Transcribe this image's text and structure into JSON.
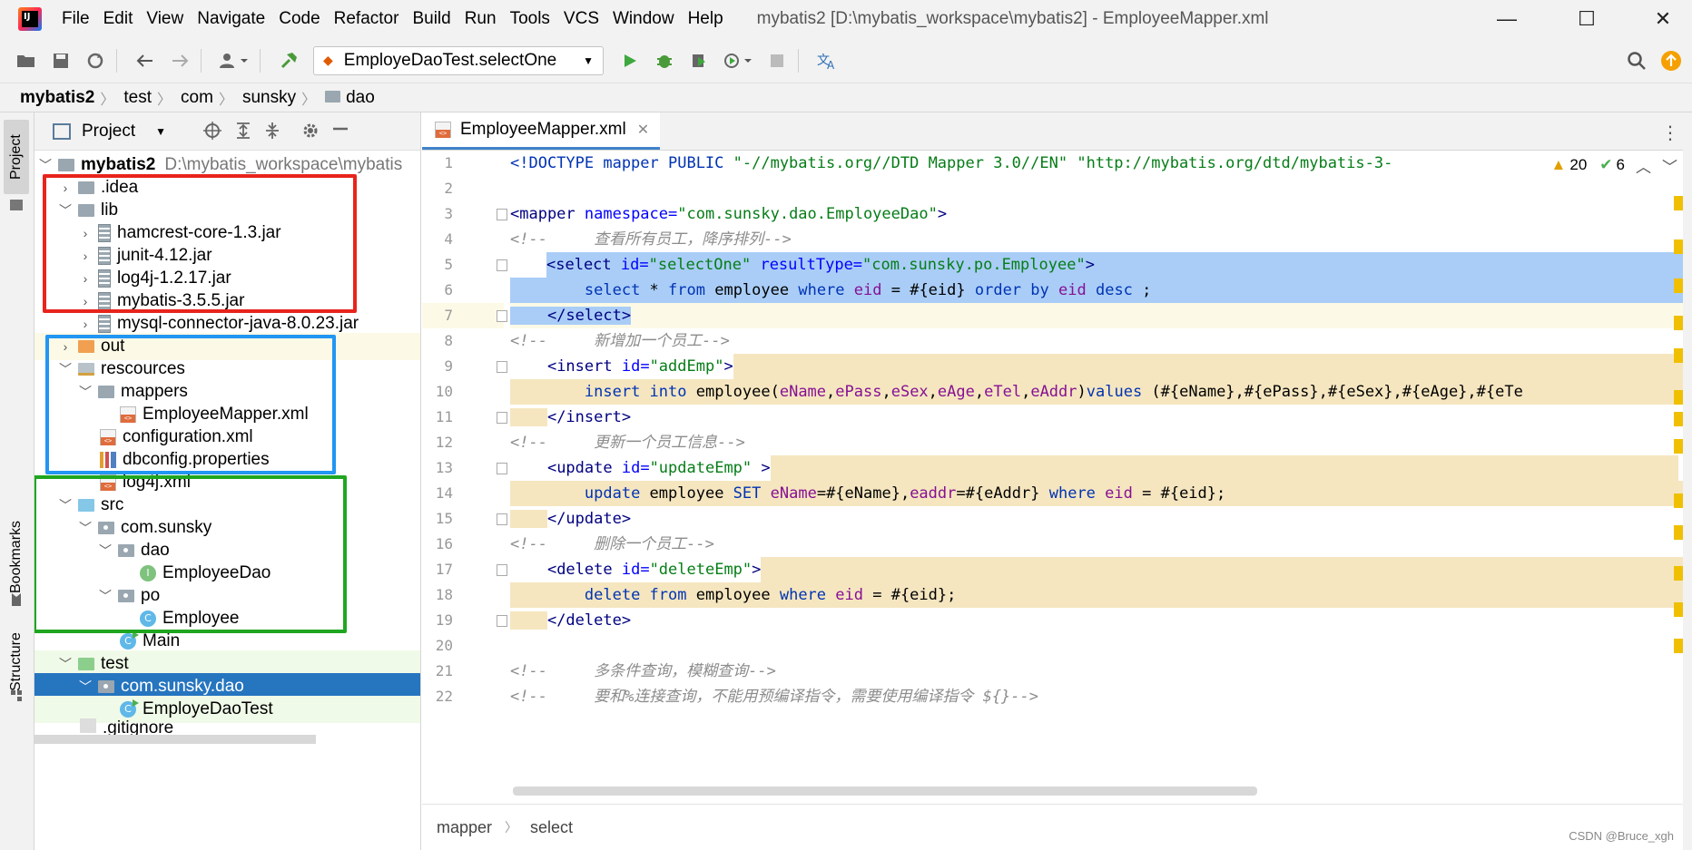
{
  "menubar": {
    "items": [
      "File",
      "Edit",
      "View",
      "Navigate",
      "Code",
      "Refactor",
      "Build",
      "Run",
      "Tools",
      "VCS",
      "Window",
      "Help"
    ],
    "window_title": "mybatis2 [D:\\mybatis_workspace\\mybatis2] - EmployeeMapper.xml",
    "minimize": "—",
    "maximize": "☐",
    "close": "✕"
  },
  "toolbar": {
    "run_config": "EmployeDaoTest.selectOne"
  },
  "breadcrumb": [
    "mybatis2",
    "test",
    "com",
    "sunsky",
    "dao"
  ],
  "left_strip": {
    "project": "Project",
    "bookmarks": "Bookmarks",
    "structure": "Structure"
  },
  "project_panel": {
    "title": "Project",
    "tree": [
      {
        "label": "mybatis2",
        "path": "D:\\mybatis_workspace\\mybatis",
        "icon": "project-folder-icon"
      },
      {
        "label": ".idea",
        "icon": "folder-icon"
      },
      {
        "label": "lib",
        "icon": "folder-icon"
      },
      {
        "label": "hamcrest-core-1.3.jar",
        "icon": "jar-icon"
      },
      {
        "label": "junit-4.12.jar",
        "icon": "jar-icon"
      },
      {
        "label": "log4j-1.2.17.jar",
        "icon": "jar-icon"
      },
      {
        "label": "mybatis-3.5.5.jar",
        "icon": "jar-icon"
      },
      {
        "label": "mysql-connector-java-8.0.23.jar",
        "icon": "jar-icon"
      },
      {
        "label": "out",
        "icon": "excluded-folder-icon"
      },
      {
        "label": "rescources",
        "icon": "resources-folder-icon"
      },
      {
        "label": "mappers",
        "icon": "folder-icon"
      },
      {
        "label": "EmployeeMapper.xml",
        "icon": "xml-file-icon"
      },
      {
        "label": "configuration.xml",
        "icon": "xml-file-icon"
      },
      {
        "label": "dbconfig.properties",
        "icon": "properties-file-icon"
      },
      {
        "label": "log4j.xml",
        "icon": "xml-file-icon"
      },
      {
        "label": "src",
        "icon": "source-folder-icon"
      },
      {
        "label": "com.sunsky",
        "icon": "package-icon"
      },
      {
        "label": "dao",
        "icon": "package-icon"
      },
      {
        "label": "EmployeeDao",
        "icon": "interface-icon"
      },
      {
        "label": "po",
        "icon": "package-icon"
      },
      {
        "label": "Employee",
        "icon": "class-icon"
      },
      {
        "label": "Main",
        "icon": "runnable-class-icon"
      },
      {
        "label": "test",
        "icon": "test-folder-icon"
      },
      {
        "label": "com.sunsky.dao",
        "icon": "package-icon"
      },
      {
        "label": "EmployeDaoTest",
        "icon": "runnable-class-icon"
      },
      {
        "label": ".gitignore",
        "icon": "file-icon"
      }
    ],
    "highlight_colors": {
      "red": "#e8241c",
      "blue": "#2196f3",
      "green": "#1fa61f"
    }
  },
  "editor": {
    "tab": "EmployeeMapper.xml",
    "inspections": {
      "warnings": "20",
      "ok": "6"
    },
    "line_numbers": [
      "1",
      "2",
      "3",
      "4",
      "5",
      "6",
      "7",
      "8",
      "9",
      "10",
      "11",
      "12",
      "13",
      "14",
      "15",
      "16",
      "17",
      "18",
      "19",
      "20",
      "21",
      "22"
    ],
    "breadcrumb": [
      "mapper",
      "select"
    ],
    "colors": {
      "selection": "#a9cdf7",
      "sql_highlight": "#f5e6c0"
    }
  },
  "watermark": "CSDN @Bruce_xgh"
}
